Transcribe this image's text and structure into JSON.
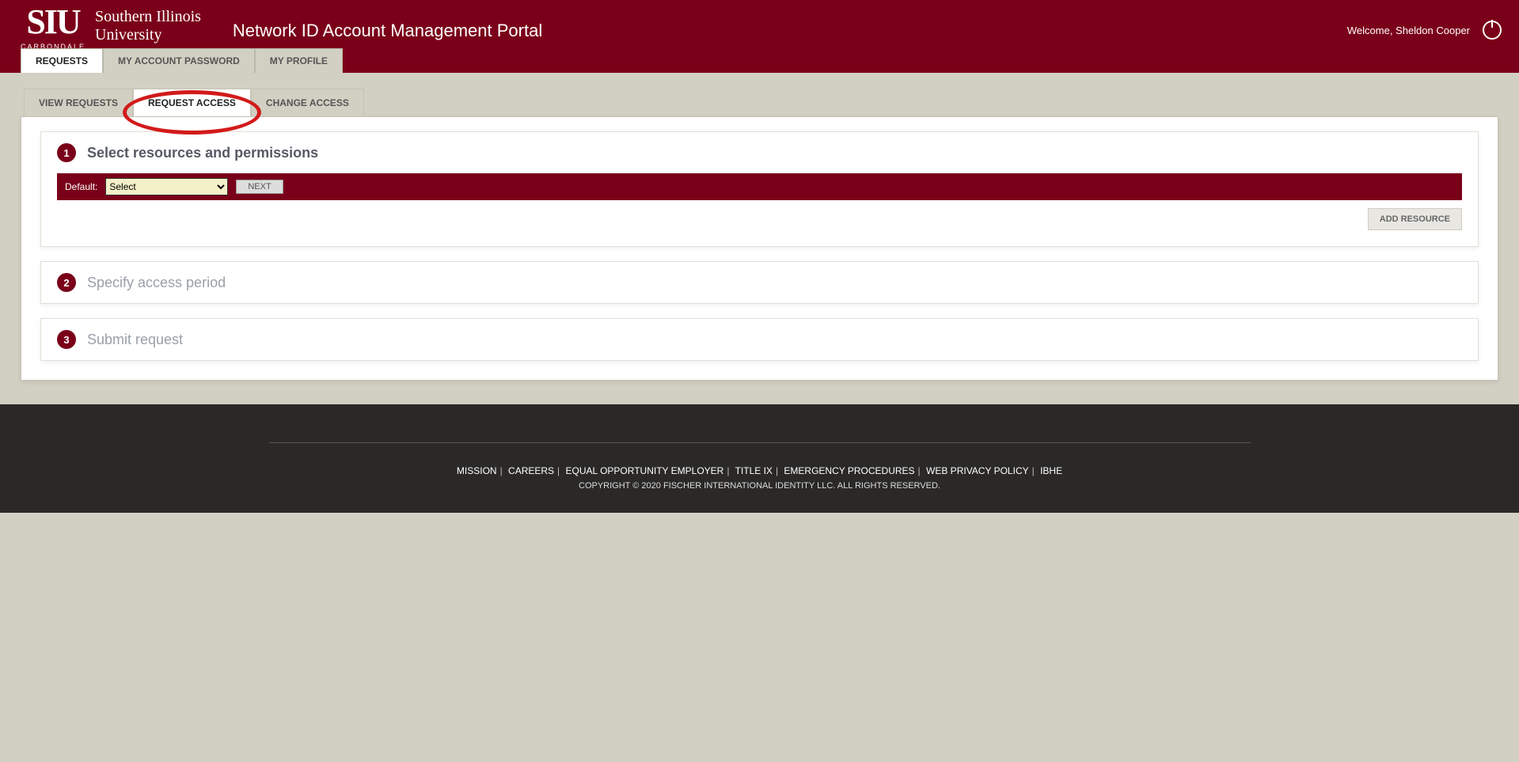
{
  "header": {
    "logo_main": "SIU",
    "logo_sub": "CARBONDALE",
    "university_line1": "Southern Illinois",
    "university_line2": "University",
    "portal_title": "Network ID Account Management Portal",
    "welcome": "Welcome, Sheldon Cooper"
  },
  "primary_tabs": [
    {
      "label": "REQUESTS",
      "active": true
    },
    {
      "label": "MY ACCOUNT PASSWORD",
      "active": false
    },
    {
      "label": "MY PROFILE",
      "active": false
    }
  ],
  "sub_tabs": [
    {
      "label": "VIEW REQUESTS",
      "active": false
    },
    {
      "label": "REQUEST ACCESS",
      "active": true
    },
    {
      "label": "CHANGE ACCESS",
      "active": false
    }
  ],
  "steps": {
    "s1": {
      "num": "1",
      "title": "Select resources and permissions"
    },
    "s2": {
      "num": "2",
      "title": "Specify access period"
    },
    "s3": {
      "num": "3",
      "title": "Submit request"
    }
  },
  "resource_bar": {
    "label": "Default:",
    "select_value": "Select",
    "next": "NEXT"
  },
  "add_resource": "ADD RESOURCE",
  "footer": {
    "links": [
      "MISSION",
      "CAREERS",
      "EQUAL OPPORTUNITY EMPLOYER",
      "TITLE IX",
      "EMERGENCY PROCEDURES",
      "WEB PRIVACY POLICY",
      "IBHE"
    ],
    "copyright": "COPYRIGHT © 2020 FISCHER INTERNATIONAL IDENTITY LLC. ALL RIGHTS RESERVED."
  }
}
